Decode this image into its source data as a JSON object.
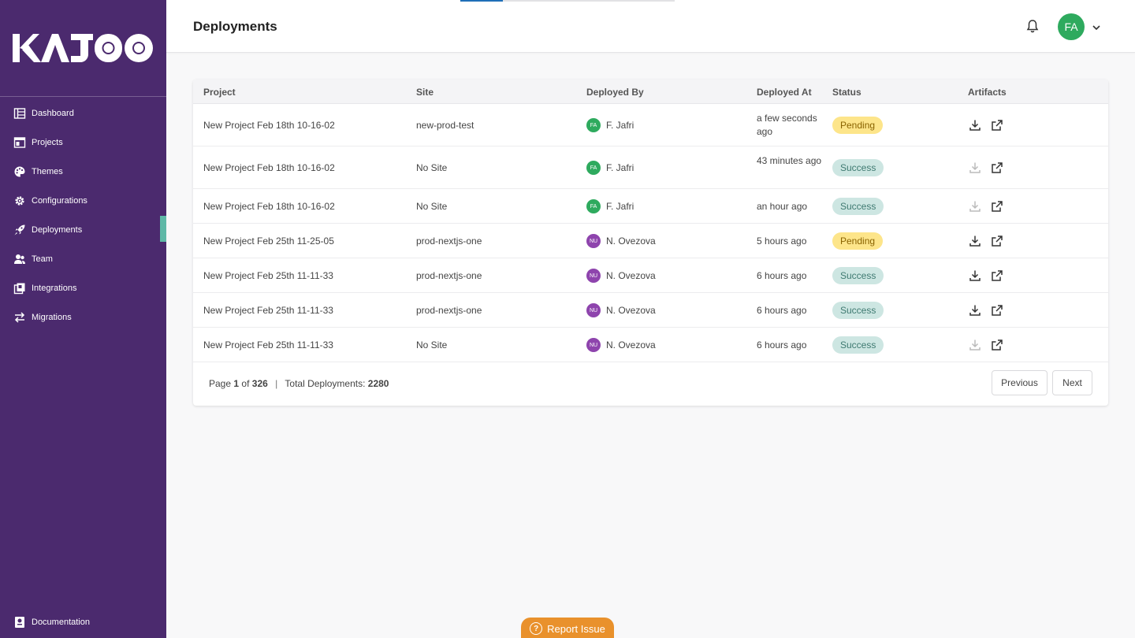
{
  "brand": {
    "logo_text": "KAJOO"
  },
  "sidebar": {
    "items": [
      {
        "label": "Dashboard",
        "icon": "dashboard-icon"
      },
      {
        "label": "Projects",
        "icon": "projects-icon"
      },
      {
        "label": "Themes",
        "icon": "palette-icon"
      },
      {
        "label": "Configurations",
        "icon": "gear-icon"
      },
      {
        "label": "Deployments",
        "icon": "rocket-icon",
        "active": true
      },
      {
        "label": "Team",
        "icon": "team-icon"
      },
      {
        "label": "Integrations",
        "icon": "integrations-icon"
      },
      {
        "label": "Migrations",
        "icon": "arrows-icon"
      }
    ],
    "documentation": "Documentation"
  },
  "header": {
    "title": "Deployments",
    "user_initials": "FA",
    "loading_progress": 0.2
  },
  "table": {
    "columns": [
      "Project",
      "Site",
      "Deployed By",
      "Deployed At",
      "Status",
      "Artifacts"
    ],
    "rows": [
      {
        "project": "New Project Feb 18th 10-16-02",
        "site": "new-prod-test",
        "initials": "FA",
        "by": "F. Jafri",
        "at": "a few seconds ago",
        "status": "Pending",
        "download_enabled": true
      },
      {
        "project": "New Project Feb 18th 10-16-02",
        "site": "No Site",
        "initials": "FA",
        "by": "F. Jafri",
        "at": "43 minutes ago",
        "status": "Success",
        "download_enabled": false
      },
      {
        "project": "New Project Feb 18th 10-16-02",
        "site": "No Site",
        "initials": "FA",
        "by": "F. Jafri",
        "at": "an hour ago",
        "status": "Success",
        "download_enabled": false
      },
      {
        "project": "New Project Feb 25th 11-25-05",
        "site": "prod-nextjs-one",
        "initials": "NU",
        "by": "N. Ovezova",
        "at": "5 hours ago",
        "status": "Pending",
        "download_enabled": true
      },
      {
        "project": "New Project Feb 25th 11-11-33",
        "site": "prod-nextjs-one",
        "initials": "NU",
        "by": "N. Ovezova",
        "at": "6 hours ago",
        "status": "Success",
        "download_enabled": true
      },
      {
        "project": "New Project Feb 25th 11-11-33",
        "site": "prod-nextjs-one",
        "initials": "NU",
        "by": "N. Ovezova",
        "at": "6 hours ago",
        "status": "Success",
        "download_enabled": true
      },
      {
        "project": "New Project Feb 25th 11-11-33",
        "site": "No Site",
        "initials": "NU",
        "by": "N. Ovezova",
        "at": "6 hours ago",
        "status": "Success",
        "download_enabled": false
      }
    ]
  },
  "pagination": {
    "page_label": "Page",
    "page": "1",
    "of_label": "of",
    "total_pages": "326",
    "total_label": "Total Deployments:",
    "total": "2280",
    "previous": "Previous",
    "next": "Next"
  },
  "report_issue": "Report Issue",
  "colors": {
    "sidebar": "#4b2a6e",
    "accent": "#5fb8a7",
    "user_green": "#2eaa5e",
    "user_purple": "#8e44ad",
    "report": "#e9912c"
  }
}
